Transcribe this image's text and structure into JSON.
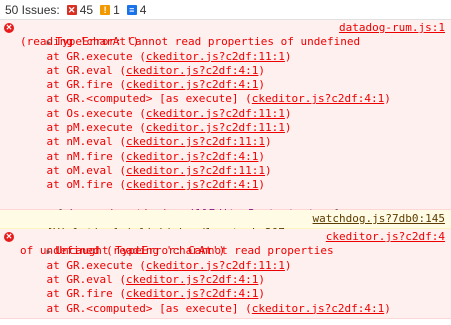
{
  "issues_bar": {
    "label": "50 Issues:",
    "errors": "45",
    "warnings": "1",
    "info": "4",
    "colors": {
      "error": "#d93025",
      "warning": "#f29900",
      "info": "#1a73e8"
    }
  },
  "messages": [
    {
      "type": "error",
      "header_line1": "TypeError: Cannot read properties of undefined ",
      "header_line2": "(reading 'charAt')",
      "source": "datadog-rum.js:1",
      "stack": [
        {
          "fn": "    at GR.execute (",
          "loc": "ckeditor.js?c2df:11:1",
          "end": ")"
        },
        {
          "fn": "    at GR.eval (",
          "loc": "ckeditor.js?c2df:4:1",
          "end": ")"
        },
        {
          "fn": "    at GR.fire (",
          "loc": "ckeditor.js?c2df:4:1",
          "end": ")"
        },
        {
          "fn": "    at GR.<computed> [as execute] (",
          "loc": "ckeditor.js?c2df:4:1",
          "end": ")"
        },
        {
          "fn": "    at Os.execute (",
          "loc": "ckeditor.js?c2df:11:1",
          "end": ")"
        },
        {
          "fn": "    at pM.execute (",
          "loc": "ckeditor.js?c2df:11:1",
          "end": ")"
        },
        {
          "fn": "    at nM.eval (",
          "loc": "ckeditor.js?c2df:11:1",
          "end": ")"
        },
        {
          "fn": "    at nM.fire (",
          "loc": "ckeditor.js?c2df:4:1",
          "end": ")"
        },
        {
          "fn": "    at oM.eval (",
          "loc": "ckeditor.js?c2df:11:1",
          "end": ")"
        },
        {
          "fn": "    at oM.fire (",
          "loc": "ckeditor.js?c2df:4:1",
          "end": ")"
        }
      ],
      "meta": {
        "open": "{",
        "k1": "phase",
        "v1": "'runtime'",
        "k2": "willEditorRestart",
        "v2": "true",
        "close": "}"
      }
    },
    {
      "type": "violation",
      "text": "[Violation] 'click' handler took 207ms",
      "source": "watchdog.js?7db0:145"
    },
    {
      "type": "error",
      "header_line1": "Uncaught TypeError: Cannot read properties",
      "header_line2": "of undefined (reading 'charAt')",
      "source": "ckeditor.js?c2df:4",
      "stack": [
        {
          "fn": "    at GR.execute (",
          "loc": "ckeditor.js?c2df:11:1",
          "end": ")"
        },
        {
          "fn": "    at GR.eval (",
          "loc": "ckeditor.js?c2df:4:1",
          "end": ")"
        },
        {
          "fn": "    at GR.fire (",
          "loc": "ckeditor.js?c2df:4:1",
          "end": ")"
        },
        {
          "fn": "    at GR.<computed> [as execute] (",
          "loc": "ckeditor.js?c2df:4:1",
          "end": ")"
        }
      ]
    }
  ]
}
